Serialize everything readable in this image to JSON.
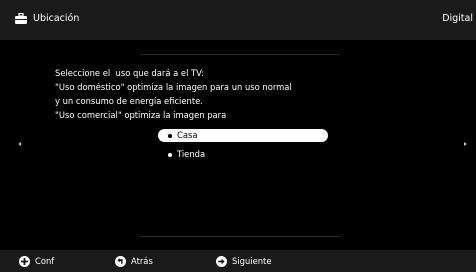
{
  "header": {
    "title": "Ubicación",
    "title_icon": "toolbox-icon",
    "right_label": "Digital"
  },
  "description": {
    "lines": [
      "Seleccione el  uso que dará a el TV:",
      "\"Uso doméstico\" optimiza la imagen para un uso normal",
      "y un consumo de energía eficiente.",
      "\"Uso comercial\" optimiza la imagen para"
    ]
  },
  "options": [
    {
      "label": "Casa",
      "selected": true
    },
    {
      "label": "Tienda",
      "selected": false
    }
  ],
  "footer": {
    "buttons": [
      {
        "label": "Conf",
        "icon": "options-icon"
      },
      {
        "label": "Atrás",
        "icon": "back-icon"
      },
      {
        "label": "Siguiente",
        "icon": "next-icon"
      }
    ]
  },
  "colors": {
    "background": "#000000",
    "bar": "#1a1a1a",
    "selected_option": "#ffffff"
  }
}
